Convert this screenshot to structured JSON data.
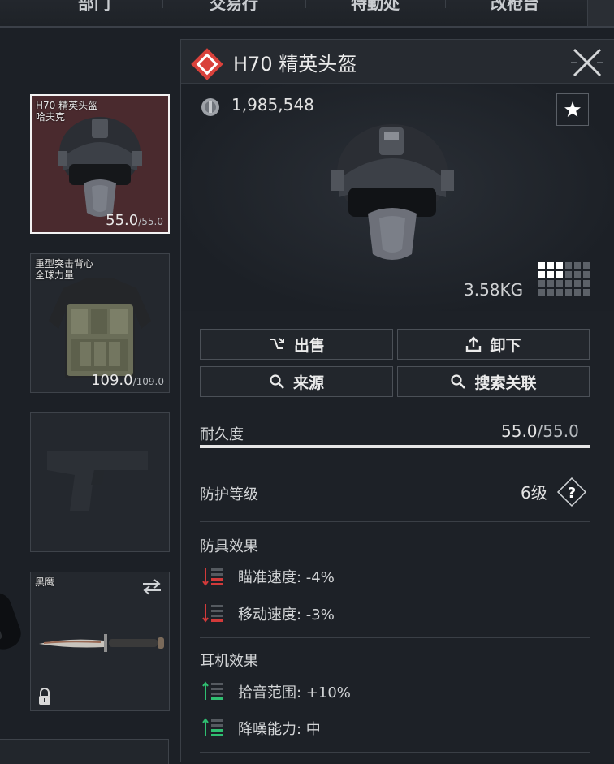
{
  "nav": {
    "tabs": [
      "部门",
      "交易行",
      "特勤处",
      "改枪台"
    ]
  },
  "slots": [
    {
      "name": "H70 精英头盔\n哈夫克",
      "durability": "55.0",
      "durability_max": "/55.0"
    },
    {
      "name": "重型突击背心\n全球力量",
      "durability": "109.0",
      "durability_max": "/109.0"
    },
    {
      "name": ""
    },
    {
      "name": "黑鹰"
    }
  ],
  "detail": {
    "title": "H70 精英头盔",
    "price": "1,985,548",
    "weight": "3.58KG",
    "buttons": {
      "sell": "出售",
      "unequip": "卸下",
      "source": "来源",
      "search_related": "搜索关联"
    },
    "durability": {
      "label": "耐久度",
      "value": "55.0",
      "max": "/55.0",
      "fraction": 1.0
    },
    "protection": {
      "label": "防护等级",
      "value": "6级"
    },
    "armor_effects": {
      "title": "防具效果",
      "items": [
        {
          "text": "瞄准速度: -4%"
        },
        {
          "text": "移动速度: -3%"
        }
      ]
    },
    "headset_effects": {
      "title": "耳机效果",
      "items": [
        {
          "text": "拾音范围: +10%"
        },
        {
          "text": "降噪能力: 中"
        }
      ]
    }
  },
  "colors": {
    "accent_red": "#e0453f",
    "negative": "#d23a3a",
    "positive": "#2fbf71",
    "selected_bg": "#4a2a2e"
  },
  "icons": [
    "sell-icon",
    "unequip-icon",
    "search-icon",
    "star-icon",
    "close-icon",
    "help-icon",
    "swap-icon",
    "lock-icon",
    "coin-icon"
  ]
}
